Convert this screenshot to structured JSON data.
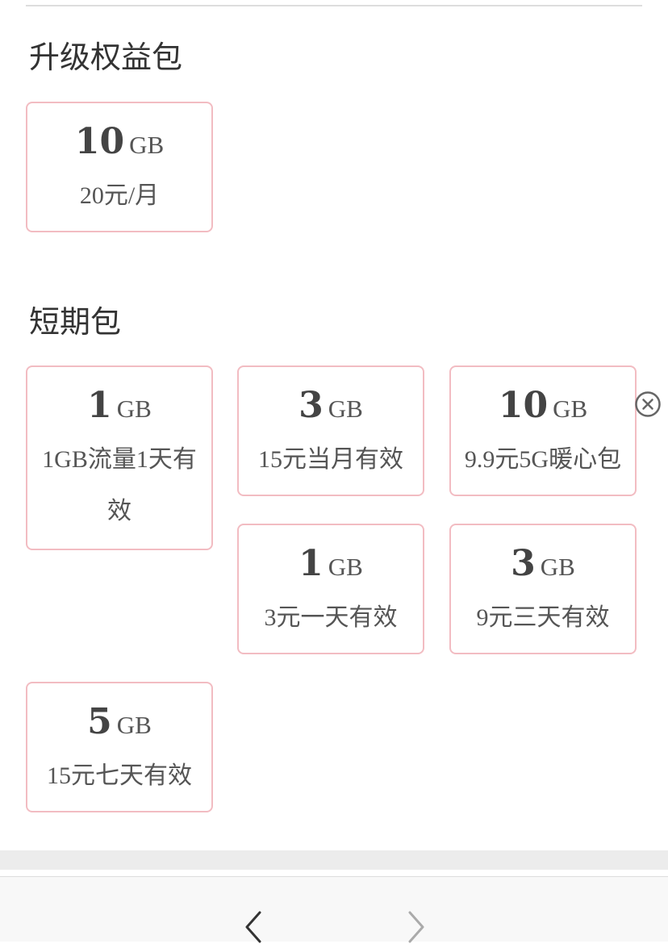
{
  "sections": {
    "upgrade": {
      "title": "升级权益包",
      "packages": [
        {
          "amount": "10",
          "unit": "GB",
          "desc": "20元/月"
        }
      ]
    },
    "short_term": {
      "title": "短期包",
      "packages": [
        {
          "amount": "1",
          "unit": "GB",
          "desc": "1GB流量1天有效"
        },
        {
          "amount": "3",
          "unit": "GB",
          "desc": "15元当月有效"
        },
        {
          "amount": "10",
          "unit": "GB",
          "desc": "9.9元5G暖心包"
        },
        {
          "amount": "1",
          "unit": "GB",
          "desc": "3元一天有效"
        },
        {
          "amount": "3",
          "unit": "GB",
          "desc": "9元三天有效"
        },
        {
          "amount": "5",
          "unit": "GB",
          "desc": "15元七天有效"
        }
      ]
    }
  },
  "icons": {
    "close": "close-circle-icon",
    "back": "chevron-left-icon",
    "forward": "chevron-right-icon"
  },
  "colors": {
    "card_border": "#f2bcc2",
    "title_text": "#333333",
    "body_text": "#555555",
    "nav_active": "#333333",
    "nav_disabled": "#aaaaaa"
  }
}
